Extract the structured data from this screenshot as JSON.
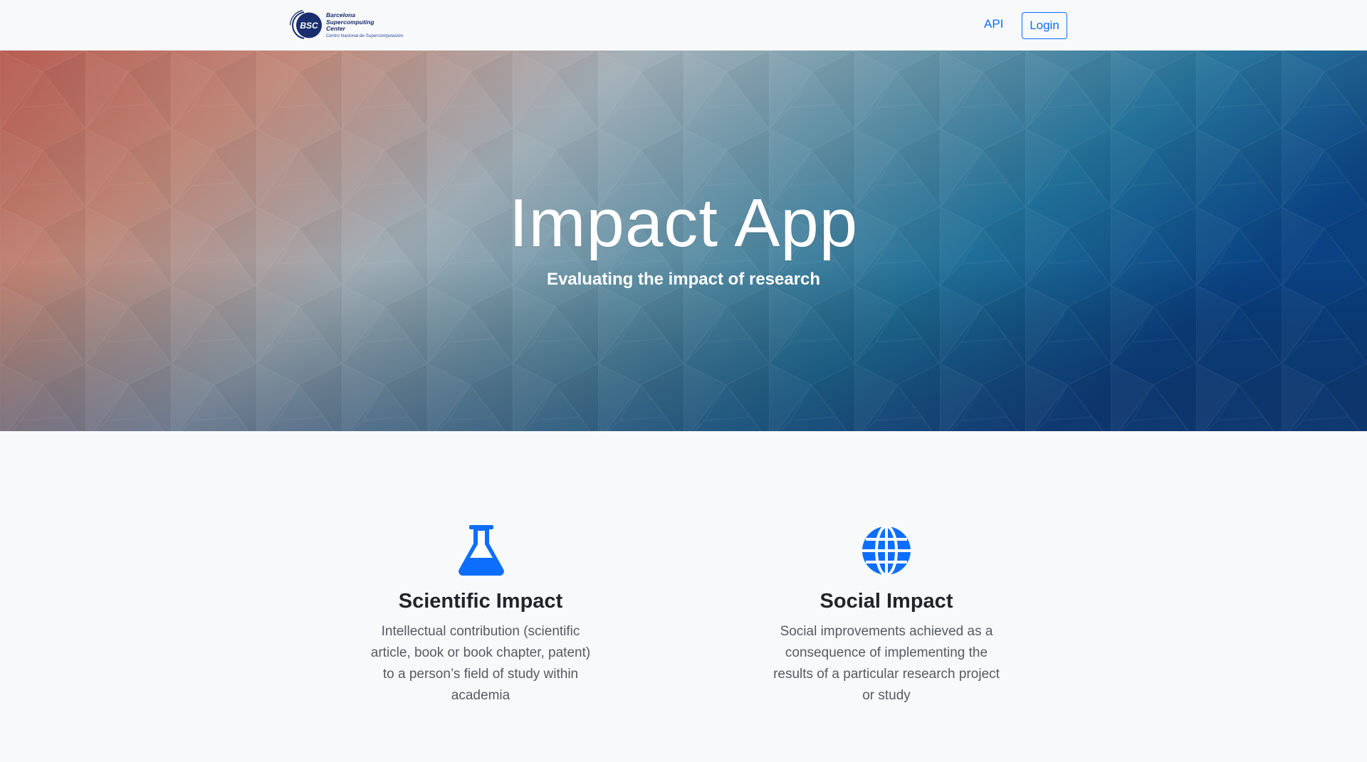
{
  "navbar": {
    "logo": {
      "mark_text": "BSC",
      "line1": "Barcelona",
      "line2": "Supercomputing",
      "line3": "Center",
      "subtitle": "Centro Nacional de Supercomputación"
    },
    "api_label": "API",
    "login_label": "Login"
  },
  "hero": {
    "title": "Impact App",
    "subtitle": "Evaluating the impact of research"
  },
  "features": {
    "scientific": {
      "icon": "flask-icon",
      "title": "Scientific Impact",
      "description": "Intellectual contribution (scientific article, book or book chapter, patent) to a person’s field of study within academia"
    },
    "social": {
      "icon": "globe-icon",
      "title": "Social Impact",
      "description": "Social improvements achieved as a consequence of implementing the results of a particular research project or study"
    }
  },
  "colors": {
    "accent": "#0d6efd",
    "background": "#f8f9fa",
    "hero_left": "#b4544a",
    "hero_center": "#7fa3b3",
    "hero_right": "#0a4f8f"
  }
}
